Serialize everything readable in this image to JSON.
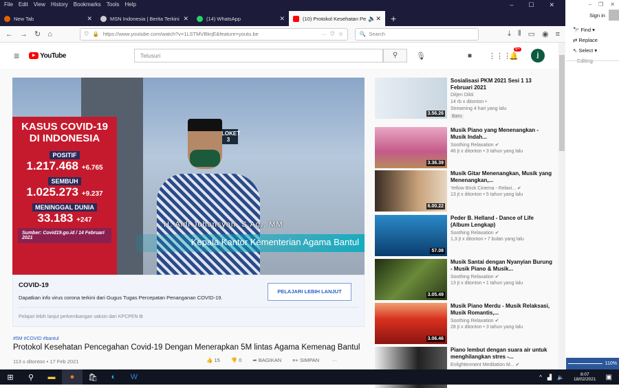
{
  "browser": {
    "menu": [
      "File",
      "Edit",
      "View",
      "History",
      "Bookmarks",
      "Tools",
      "Help"
    ],
    "tabs": [
      {
        "label": "New Tab",
        "color": "#e66000"
      },
      {
        "label": "MSN Indonesia | Berita Terkini",
        "color": "#ccc"
      },
      {
        "label": "(14) WhatsApp",
        "color": "#25d366"
      },
      {
        "label": "(10) Protokol Kesehatan Pe",
        "color": "#ff0000"
      }
    ],
    "url": "https://www.youtube.com/watch?v=1LSTMVBkrjE&feature=youtu.be",
    "search_placeholder": "Search"
  },
  "youtube": {
    "logo": "YouTube",
    "search_placeholder": "Telusuri",
    "notif_count": "9+",
    "avatar": "j",
    "video": {
      "overlay": {
        "title1": "KASUS COVID-19",
        "title2": "DI INDONESIA",
        "positif_label": "POSITIF",
        "positif": "1.217.468",
        "positif_delta": "+6.765",
        "sembuh_label": "SEMBUH",
        "sembuh": "1.025.273",
        "sembuh_delta": "+9.237",
        "meninggal_label": "MENINGGAL DUNIA",
        "meninggal": "33.183",
        "meninggal_delta": "+247",
        "source": "Sumber: Covid19.go.id / 14 Februari 2021",
        "loket": "LOKET 3",
        "name": "H. Aidi Johansyah, S.Ag., MM",
        "role": "Kepala Kantor Kementerian Agama Bantul"
      }
    },
    "card": {
      "title": "COVID-19",
      "desc": "Dapatkan info virus corona terkini dari Gugus Tugas Percepatan Penanganan COVID-19.",
      "button": "PELAJARI LEBIH LANJUT",
      "link": "Pelajari lebih lanjut perkembangan vaksin dari KPCPEN ⧉"
    },
    "tags": "#5M #COVID #bantul",
    "title": "Protokol Kesehatan Pencegahan Covid-19 Dengan Menerapkan 5M lintas Agama Kemenag Bantul",
    "meta": "113 x ditonton • 17 Feb 2021",
    "likes": "15",
    "dislikes": "0",
    "share": "BAGIKAN",
    "save": "SIMPAN",
    "sidebar": [
      {
        "title": "Sosialisasi PKM 2021 Sesi 1 13 Februari 2021",
        "channel": "Ditjen Dikti",
        "views": "14 rb x ditonton •",
        "extra": "Streaming 4 hari yang lalu",
        "badge": "Baru",
        "duration": "3.56.26",
        "bg": "linear-gradient(90deg,#e8eef4,#c9d6e0)"
      },
      {
        "title": "Musik Piano yang Menenangkan - Musik Indah...",
        "channel": "Soothing Relaxation ✔",
        "views": "46 jt x ditonton • 3 tahun yang lalu",
        "duration": "3.36.39",
        "bg": "linear-gradient(180deg,#e9a6c4,#c45b8a 60%,#b78a5b)"
      },
      {
        "title": "Musik Gitar Menenangkan, Musik yang Menenangkan,...",
        "channel": "Yellow Brick Cinema - Relaxi... ✔",
        "views": "13 jt x ditonton • 5 tahun yang lalu",
        "duration": "6.00.22",
        "bg": "linear-gradient(90deg,#3a2c22,#c8a27a 60%,#e7d6c2)"
      },
      {
        "title": "Peder B. Helland - Dance of Life (Album Lengkap)",
        "channel": "Soothing Relaxation ✔",
        "views": "1,3 jt x ditonton • 7 bulan yang lalu",
        "duration": "57.08",
        "bg": "linear-gradient(180deg,#2a8ac8,#0b3d6e)"
      },
      {
        "title": "Musik Santai dengan Nyanyian Burung - Musik Piano & Musik...",
        "channel": "Soothing Relaxation ✔",
        "views": "13 jt x ditonton • 1 tahun yang lalu",
        "duration": "3.05.49",
        "bg": "linear-gradient(135deg,#1f2e12,#6a8a3a 50%,#2c3a18)"
      },
      {
        "title": "Musik Piano Merdu - Musik Relaksasi, Musik Romantis,...",
        "channel": "Soothing Relaxation ✔",
        "views": "28 jt x ditonton • 3 tahun yang lalu",
        "duration": "3.06.46",
        "bg": "linear-gradient(180deg,#f0a070,#d8301e 40%,#8a1410)"
      },
      {
        "title": "Piano lembut dengan suara air untuk menghilangkan stres -...",
        "channel": "Enlightenment Meditation M... ✔",
        "views": "",
        "duration": "",
        "bg": "linear-gradient(90deg,#eee,#222 60%,#555)"
      }
    ]
  },
  "word": {
    "sign_in": "Sign in",
    "find": "Find ▾",
    "replace": "Replace",
    "select": "Select ▾",
    "group": "Editing",
    "zoom": "110%"
  },
  "taskbar": {
    "time": "8:07",
    "date": "18/02/2021"
  }
}
